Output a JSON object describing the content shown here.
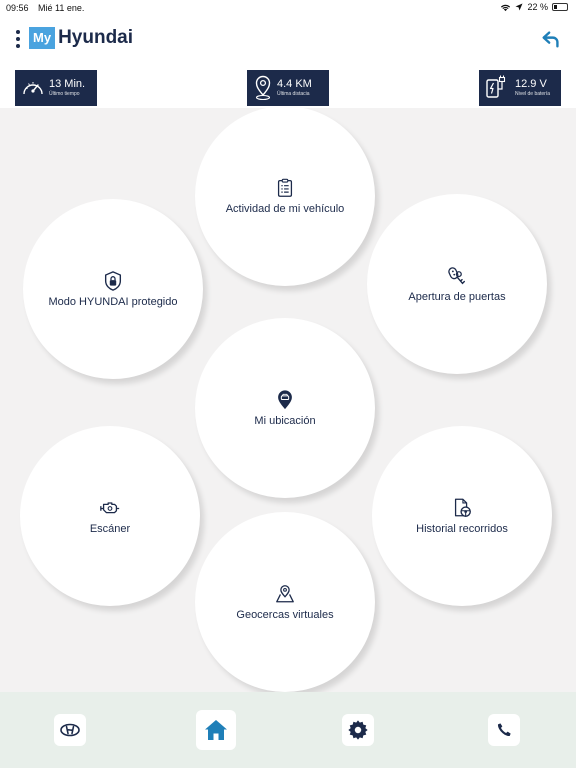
{
  "status": {
    "time": "09:56",
    "date": "Mié 11 ene.",
    "battery": "22 %"
  },
  "header": {
    "logo_my": "My",
    "logo_brand": "Hyundai",
    "menu_icon": "more-vertical-icon",
    "back_icon": "back-arrow-icon"
  },
  "stats": [
    {
      "value": "13 Min.",
      "label": "Último tiempo",
      "icon": "speedometer-icon"
    },
    {
      "value": "4.4 KM",
      "label": "Última distacia",
      "icon": "map-pin-icon"
    },
    {
      "value": "12.9 V",
      "label": "Nivel de batería",
      "icon": "battery-plug-icon"
    }
  ],
  "features": [
    {
      "label": "Actividad de mi vehículo",
      "icon": "clipboard-list-icon"
    },
    {
      "label": "Modo HYUNDAI protegido",
      "icon": "shield-lock-icon"
    },
    {
      "label": "Apertura de puertas",
      "icon": "car-keys-icon"
    },
    {
      "label": "Mi ubicación",
      "icon": "car-location-icon"
    },
    {
      "label": "Escáner",
      "icon": "engine-scanner-icon"
    },
    {
      "label": "Historial recorridos",
      "icon": "route-history-icon"
    },
    {
      "label": "Geocercas virtuales",
      "icon": "geofence-map-icon"
    }
  ],
  "nav": [
    {
      "icon": "hyundai-logo-icon"
    },
    {
      "icon": "home-icon",
      "active": true
    },
    {
      "icon": "gear-icon"
    },
    {
      "icon": "phone-icon"
    }
  ],
  "colors": {
    "navy": "#1c2a4a",
    "accent_blue": "#4aa3df",
    "home_blue": "#1f7fb8",
    "background": "#f3f2f2",
    "nav_bar": "#e8efea"
  }
}
